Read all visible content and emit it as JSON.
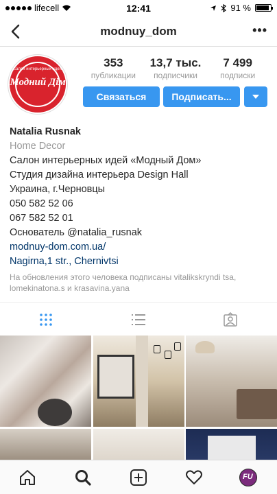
{
  "status_bar": {
    "carrier": "lifecell",
    "time": "12:41",
    "battery": "91 %",
    "battery_level": 0.91
  },
  "nav": {
    "title": "modnuy_dom",
    "more": "•••"
  },
  "profile": {
    "avatar": {
      "small_text": "салон интерьерных идей",
      "brand_text": "Модний Дім"
    },
    "stats": [
      {
        "value": "353",
        "label": "публикации"
      },
      {
        "value": "13,7 тыс.",
        "label": "подписчики"
      },
      {
        "value": "7 499",
        "label": "подписки"
      }
    ],
    "buttons": {
      "contact": "Связаться",
      "follow": "Подписать..."
    },
    "bio": {
      "name": "Natalia Rusnak",
      "category": "Home Decor",
      "lines": [
        "Салон интерьерных идей «Модный Дом»",
        "Студия дизайна интерьера Design Hall",
        "Украина, г.Черновцы",
        "050 582 52 06",
        "067 582 52 01",
        "Основатель @natalia_rusnak"
      ],
      "website": "modnuy-dom.com.ua/",
      "address": "Nagirna,1 str., Chernivtsi",
      "followed_by": "На обновления этого человека подписаны vitalikskryndi tsa, lomekinatona.s и krasavina.yana"
    }
  },
  "tabs": [
    "grid-view",
    "list-view",
    "tagged-view"
  ],
  "bottom_bar": {
    "avatar_text": "FU"
  },
  "colors": {
    "primary_button": "#3897f0",
    "link": "#003569",
    "muted": "#999999"
  }
}
